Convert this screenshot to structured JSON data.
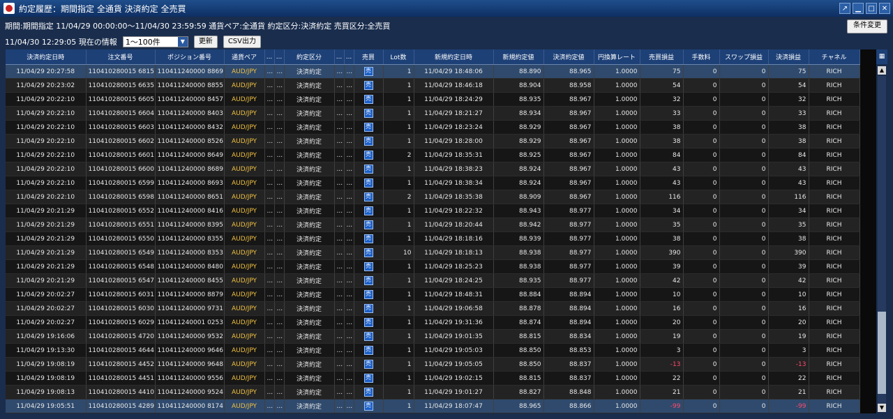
{
  "window": {
    "title": "約定履歴：期間指定 全通貨 決済約定 全売買"
  },
  "filter": {
    "summary": "期間:期間指定 11/04/29 00:00:00～11/04/30 23:59:59 通貨ペア:全通貨 約定区分:決済約定 売買区分:全売買",
    "change_button": "条件変更",
    "info_time": "11/04/30 12:29:05 現在の情報",
    "range_selected": "1～100件",
    "refresh_button": "更新",
    "csv_button": "CSV出力"
  },
  "table": {
    "headers": [
      "決済約定日時",
      "注文番号",
      "ポジション番号",
      "通貨ペア",
      "...",
      "...",
      "約定区分",
      "...",
      "...",
      "売買",
      "Lot数",
      "新規約定日時",
      "新規約定値",
      "決済約定値",
      "円換算レート",
      "売買損益",
      "手数料",
      "スワップ損益",
      "決済損益",
      "チャネル"
    ],
    "rows": [
      [
        "11/04/29 20:27:58",
        "110410280015 6815",
        "110411240000 8869",
        "AUD/JPY",
        "...",
        "...",
        "決済約定",
        "...",
        "...",
        "売",
        "1",
        "11/04/29 18:48:06",
        "88.890",
        "88.965",
        "1.0000",
        "75",
        "0",
        "0",
        "75",
        "RICH"
      ],
      [
        "11/04/29 20:23:02",
        "110410280015 6635",
        "110411240000 8855",
        "AUD/JPY",
        "...",
        "...",
        "決済約定",
        "...",
        "...",
        "売",
        "1",
        "11/04/29 18:46:18",
        "88.904",
        "88.958",
        "1.0000",
        "54",
        "0",
        "0",
        "54",
        "RICH"
      ],
      [
        "11/04/29 20:22:10",
        "110410280015 6605",
        "110411240000 8457",
        "AUD/JPY",
        "...",
        "...",
        "決済約定",
        "...",
        "...",
        "売",
        "1",
        "11/04/29 18:24:29",
        "88.935",
        "88.967",
        "1.0000",
        "32",
        "0",
        "0",
        "32",
        "RICH"
      ],
      [
        "11/04/29 20:22:10",
        "110410280015 6604",
        "110411240000 8403",
        "AUD/JPY",
        "...",
        "...",
        "決済約定",
        "...",
        "...",
        "売",
        "1",
        "11/04/29 18:21:27",
        "88.934",
        "88.967",
        "1.0000",
        "33",
        "0",
        "0",
        "33",
        "RICH"
      ],
      [
        "11/04/29 20:22:10",
        "110410280015 6603",
        "110411240000 8432",
        "AUD/JPY",
        "...",
        "...",
        "決済約定",
        "...",
        "...",
        "売",
        "1",
        "11/04/29 18:23:24",
        "88.929",
        "88.967",
        "1.0000",
        "38",
        "0",
        "0",
        "38",
        "RICH"
      ],
      [
        "11/04/29 20:22:10",
        "110410280015 6602",
        "110411240000 8526",
        "AUD/JPY",
        "...",
        "...",
        "決済約定",
        "...",
        "...",
        "売",
        "1",
        "11/04/29 18:28:00",
        "88.929",
        "88.967",
        "1.0000",
        "38",
        "0",
        "0",
        "38",
        "RICH"
      ],
      [
        "11/04/29 20:22:10",
        "110410280015 6601",
        "110411240000 8649",
        "AUD/JPY",
        "...",
        "...",
        "決済約定",
        "...",
        "...",
        "売",
        "2",
        "11/04/29 18:35:31",
        "88.925",
        "88.967",
        "1.0000",
        "84",
        "0",
        "0",
        "84",
        "RICH"
      ],
      [
        "11/04/29 20:22:10",
        "110410280015 6600",
        "110411240000 8689",
        "AUD/JPY",
        "...",
        "...",
        "決済約定",
        "...",
        "...",
        "売",
        "1",
        "11/04/29 18:38:23",
        "88.924",
        "88.967",
        "1.0000",
        "43",
        "0",
        "0",
        "43",
        "RICH"
      ],
      [
        "11/04/29 20:22:10",
        "110410280015 6599",
        "110411240000 8693",
        "AUD/JPY",
        "...",
        "...",
        "決済約定",
        "...",
        "...",
        "売",
        "1",
        "11/04/29 18:38:34",
        "88.924",
        "88.967",
        "1.0000",
        "43",
        "0",
        "0",
        "43",
        "RICH"
      ],
      [
        "11/04/29 20:22:10",
        "110410280015 6598",
        "110411240000 8651",
        "AUD/JPY",
        "...",
        "...",
        "決済約定",
        "...",
        "...",
        "売",
        "2",
        "11/04/29 18:35:38",
        "88.909",
        "88.967",
        "1.0000",
        "116",
        "0",
        "0",
        "116",
        "RICH"
      ],
      [
        "11/04/29 20:21:29",
        "110410280015 6552",
        "110411240000 8416",
        "AUD/JPY",
        "...",
        "...",
        "決済約定",
        "...",
        "...",
        "売",
        "1",
        "11/04/29 18:22:32",
        "88.943",
        "88.977",
        "1.0000",
        "34",
        "0",
        "0",
        "34",
        "RICH"
      ],
      [
        "11/04/29 20:21:29",
        "110410280015 6551",
        "110411240000 8395",
        "AUD/JPY",
        "...",
        "...",
        "決済約定",
        "...",
        "...",
        "売",
        "1",
        "11/04/29 18:20:44",
        "88.942",
        "88.977",
        "1.0000",
        "35",
        "0",
        "0",
        "35",
        "RICH"
      ],
      [
        "11/04/29 20:21:29",
        "110410280015 6550",
        "110411240000 8355",
        "AUD/JPY",
        "...",
        "...",
        "決済約定",
        "...",
        "...",
        "売",
        "1",
        "11/04/29 18:18:16",
        "88.939",
        "88.977",
        "1.0000",
        "38",
        "0",
        "0",
        "38",
        "RICH"
      ],
      [
        "11/04/29 20:21:29",
        "110410280015 6549",
        "110411240000 8353",
        "AUD/JPY",
        "...",
        "...",
        "決済約定",
        "...",
        "...",
        "売",
        "10",
        "11/04/29 18:18:13",
        "88.938",
        "88.977",
        "1.0000",
        "390",
        "0",
        "0",
        "390",
        "RICH"
      ],
      [
        "11/04/29 20:21:29",
        "110410280015 6548",
        "110411240000 8480",
        "AUD/JPY",
        "...",
        "...",
        "決済約定",
        "...",
        "...",
        "売",
        "1",
        "11/04/29 18:25:23",
        "88.938",
        "88.977",
        "1.0000",
        "39",
        "0",
        "0",
        "39",
        "RICH"
      ],
      [
        "11/04/29 20:21:29",
        "110410280015 6547",
        "110411240000 8455",
        "AUD/JPY",
        "...",
        "...",
        "決済約定",
        "...",
        "...",
        "売",
        "1",
        "11/04/29 18:24:25",
        "88.935",
        "88.977",
        "1.0000",
        "42",
        "0",
        "0",
        "42",
        "RICH"
      ],
      [
        "11/04/29 20:02:27",
        "110410280015 6031",
        "110411240000 8879",
        "AUD/JPY",
        "...",
        "...",
        "決済約定",
        "...",
        "...",
        "売",
        "1",
        "11/04/29 18:48:31",
        "88.884",
        "88.894",
        "1.0000",
        "10",
        "0",
        "0",
        "10",
        "RICH"
      ],
      [
        "11/04/29 20:02:27",
        "110410280015 6030",
        "110411240000 9731",
        "AUD/JPY",
        "...",
        "...",
        "決済約定",
        "...",
        "...",
        "売",
        "1",
        "11/04/29 19:06:58",
        "88.878",
        "88.894",
        "1.0000",
        "16",
        "0",
        "0",
        "16",
        "RICH"
      ],
      [
        "11/04/29 20:02:27",
        "110410280015 6029",
        "110411240001 0253",
        "AUD/JPY",
        "...",
        "...",
        "決済約定",
        "...",
        "...",
        "売",
        "1",
        "11/04/29 19:31:36",
        "88.874",
        "88.894",
        "1.0000",
        "20",
        "0",
        "0",
        "20",
        "RICH"
      ],
      [
        "11/04/29 19:16:06",
        "110410280015 4720",
        "110411240000 9532",
        "AUD/JPY",
        "...",
        "...",
        "決済約定",
        "...",
        "...",
        "売",
        "1",
        "11/04/29 19:01:35",
        "88.815",
        "88.834",
        "1.0000",
        "19",
        "0",
        "0",
        "19",
        "RICH"
      ],
      [
        "11/04/29 19:13:30",
        "110410280015 4644",
        "110411240000 9646",
        "AUD/JPY",
        "...",
        "...",
        "決済約定",
        "...",
        "...",
        "売",
        "1",
        "11/04/29 19:05:03",
        "88.850",
        "88.853",
        "1.0000",
        "3",
        "0",
        "0",
        "3",
        "RICH"
      ],
      [
        "11/04/29 19:08:19",
        "110410280015 4452",
        "110411240000 9648",
        "AUD/JPY",
        "...",
        "...",
        "決済約定",
        "...",
        "...",
        "売",
        "1",
        "11/04/29 19:05:05",
        "88.850",
        "88.837",
        "1.0000",
        "-13",
        "0",
        "0",
        "-13",
        "RICH"
      ],
      [
        "11/04/29 19:08:19",
        "110410280015 4451",
        "110411240000 9556",
        "AUD/JPY",
        "...",
        "...",
        "決済約定",
        "...",
        "...",
        "売",
        "1",
        "11/04/29 19:02:15",
        "88.815",
        "88.837",
        "1.0000",
        "22",
        "0",
        "0",
        "22",
        "RICH"
      ],
      [
        "11/04/29 19:08:13",
        "110410280015 4410",
        "110411240000 9524",
        "AUD/JPY",
        "...",
        "...",
        "決済約定",
        "...",
        "...",
        "売",
        "1",
        "11/04/29 19:01:27",
        "88.827",
        "88.848",
        "1.0000",
        "21",
        "0",
        "0",
        "21",
        "RICH"
      ],
      [
        "11/04/29 19:05:51",
        "110410280015 4289",
        "110411240000 8174",
        "AUD/JPY",
        "...",
        "...",
        "決済約定",
        "...",
        "...",
        "売",
        "1",
        "11/04/29 18:07:47",
        "88.965",
        "88.866",
        "1.0000",
        "-99",
        "0",
        "0",
        "-99",
        "RICH"
      ]
    ]
  },
  "colors": {
    "accent": "#1d4077",
    "pair": "#f0c040",
    "negative": "#ff4b6b"
  }
}
